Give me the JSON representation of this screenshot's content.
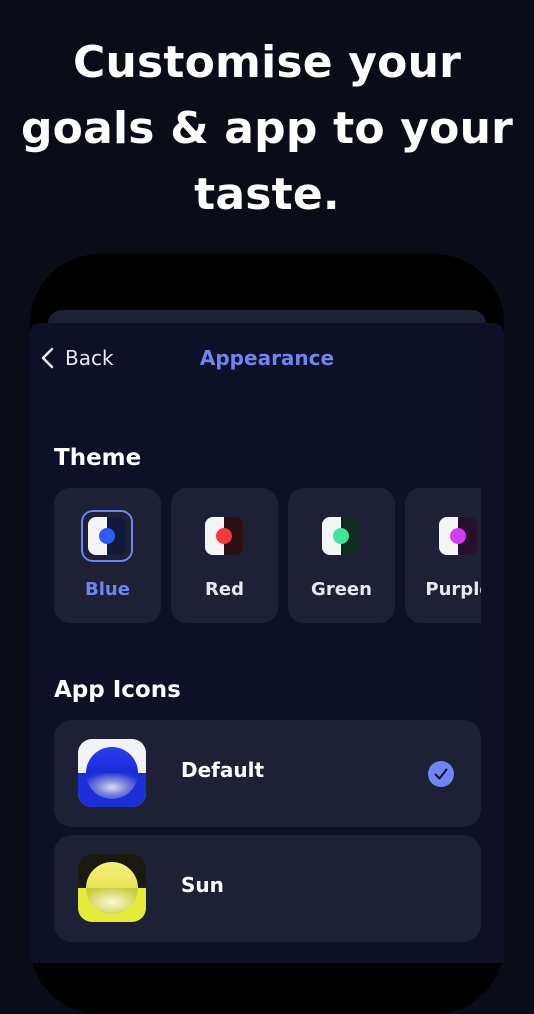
{
  "headline": {
    "line1": "Customise your",
    "line2": "goals & app to your",
    "line3": "taste."
  },
  "nav": {
    "back_label": "Back",
    "title": "Appearance"
  },
  "theme": {
    "section_title": "Theme",
    "options": [
      {
        "label": "Blue",
        "dot_color": "#2f5cf5",
        "dark_color": "#101a3a",
        "selected": true
      },
      {
        "label": "Red",
        "dot_color": "#f23a3a",
        "dark_color": "#2a1014",
        "selected": false
      },
      {
        "label": "Green",
        "dot_color": "#3ee69a",
        "dark_color": "#0f2a1e",
        "selected": false
      },
      {
        "label": "Purple",
        "dot_color": "#d33ff0",
        "dark_color": "#261030",
        "selected": false
      }
    ]
  },
  "app_icons": {
    "section_title": "App Icons",
    "options": [
      {
        "label": "Default",
        "icon": "blue-sphere-app-icon",
        "selected": true
      },
      {
        "label": "Sun",
        "icon": "yellow-sphere-app-icon",
        "selected": false
      }
    ]
  },
  "colors": {
    "accent": "#6f86f0",
    "card_background": "#1e2035",
    "sheet_background": "#0d1026"
  }
}
